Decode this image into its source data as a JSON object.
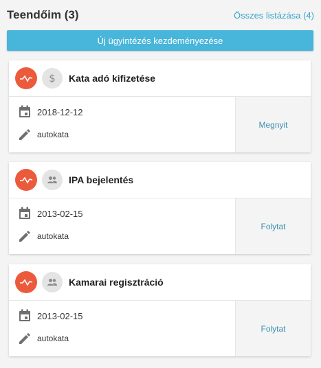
{
  "header": {
    "title": "Teendőim (3)",
    "list_all_link": "Összes listázása (4)"
  },
  "new_case_button": "Új ügyintézés kezdeményezése",
  "colors": {
    "accent": "#48b5da",
    "status": "#ec5a3c",
    "link": "#3ba6c9"
  },
  "cards": [
    {
      "title": "Kata adó kifizetése",
      "status_icon": "activity-icon",
      "type_icon": "dollar-icon",
      "date": "2018-12-12",
      "owner": "autokata",
      "action": "Megnyit"
    },
    {
      "title": "IPA bejelentés",
      "status_icon": "activity-icon",
      "type_icon": "people-icon",
      "date": "2013-02-15",
      "owner": "autokata",
      "action": "Folytat"
    },
    {
      "title": "Kamarai regisztráció",
      "status_icon": "activity-icon",
      "type_icon": "people-icon",
      "date": "2013-02-15",
      "owner": "autokata",
      "action": "Folytat"
    }
  ]
}
